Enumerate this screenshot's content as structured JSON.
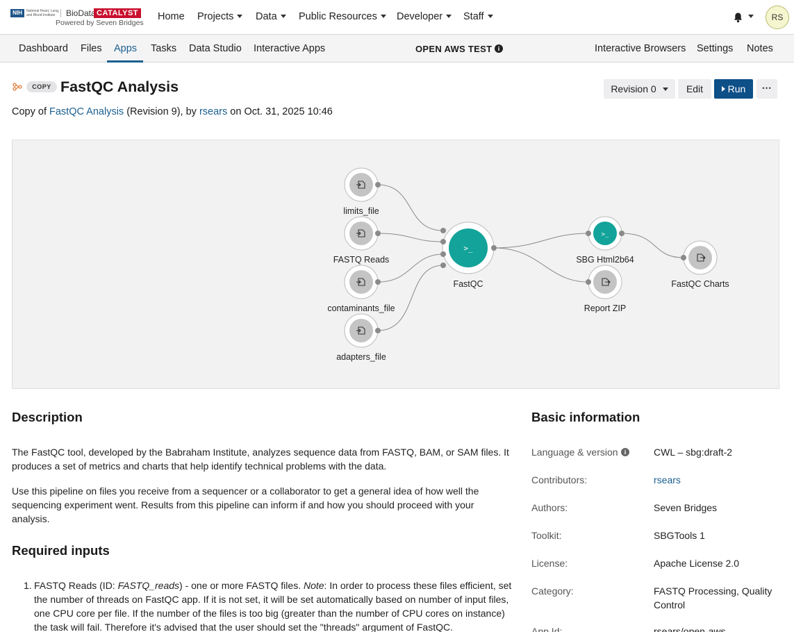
{
  "brand": {
    "nih": "NIH",
    "institute": "National Heart, Lung, and Blood Institute",
    "name_left": "BioData",
    "name_right": "CATALYST",
    "powered_by": "Powered by Seven Bridges"
  },
  "topnav": {
    "items": [
      {
        "label": "Home"
      },
      {
        "label": "Projects"
      },
      {
        "label": "Data"
      },
      {
        "label": "Public Resources"
      },
      {
        "label": "Developer"
      },
      {
        "label": "Staff"
      }
    ],
    "avatar": "RS"
  },
  "subnav": {
    "items": [
      {
        "label": "Dashboard"
      },
      {
        "label": "Files"
      },
      {
        "label": "Apps"
      },
      {
        "label": "Tasks"
      },
      {
        "label": "Data Studio"
      },
      {
        "label": "Interactive Apps"
      }
    ],
    "active": "Apps",
    "project_title": "OPEN AWS TEST",
    "right_items": [
      {
        "label": "Interactive Browsers"
      },
      {
        "label": "Settings"
      },
      {
        "label": "Notes"
      }
    ]
  },
  "app": {
    "badge": "COPY",
    "title": "FastQC Analysis",
    "revision_label": "Revision 0",
    "edit_label": "Edit",
    "run_label": "Run",
    "more_label": "⋯",
    "copy_prefix": "Copy of ",
    "copy_source": "FastQC Analysis",
    "copy_mid": " (Revision 9), by ",
    "copy_author": "rsears",
    "copy_suffix": " on Oct. 31, 2025 10:46"
  },
  "workflow": {
    "inputs": [
      "limits_file",
      "FASTQ Reads",
      "contaminants_file",
      "adapters_file"
    ],
    "tool": "FastQC",
    "steps": [
      "SBG Html2b64"
    ],
    "outputs": [
      "Report ZIP",
      "FastQC Charts"
    ]
  },
  "description": {
    "heading": "Description",
    "p1": "The FastQC tool, developed by the Babraham Institute, analyzes sequence data from FASTQ, BAM, or SAM files. It produces a set of metrics and charts that help identify technical problems with the data.",
    "p2": "Use this pipeline on files you receive from a sequencer or a collaborator to get a general idea of how well the sequencing experiment went. Results from this pipeline can inform if and how you should proceed with your analysis.",
    "required_heading": "Required inputs",
    "req1_num": "1.",
    "req1_a": "FASTQ Reads (ID: ",
    "req1_id": "FASTQ_reads",
    "req1_b": ") - one or more FASTQ files. ",
    "req1_note": "Note",
    "req1_c": ": In order to process these files efficient, set the number of threads on FastQC app. If it is not set, it will be set automatically based on number of input files, one CPU core per file. If the number of the files is too big (greater than the number of CPU cores on instance) the task will fail. Therefore it's advised that the user should set the \"threads\" argument of FastQC."
  },
  "basic_info": {
    "heading": "Basic information",
    "rows": [
      {
        "key": "Language & version",
        "value": "CWL – sbg:draft-2"
      },
      {
        "key": "Contributors:",
        "value": "rsears"
      },
      {
        "key": "Authors:",
        "value": "Seven Bridges"
      },
      {
        "key": "Toolkit:",
        "value": "SBGTools 1"
      },
      {
        "key": "License:",
        "value": "Apache License 2.0"
      },
      {
        "key": "Category:",
        "value": "FASTQ Processing, Quality Control"
      },
      {
        "key": "App Id:",
        "value": "rsears/open-aws..."
      }
    ]
  },
  "colors": {
    "accent": "#1b5f8f",
    "run_button": "#0d4f87",
    "tool_node": "#13a39a",
    "brand_red": "#c8102e"
  }
}
